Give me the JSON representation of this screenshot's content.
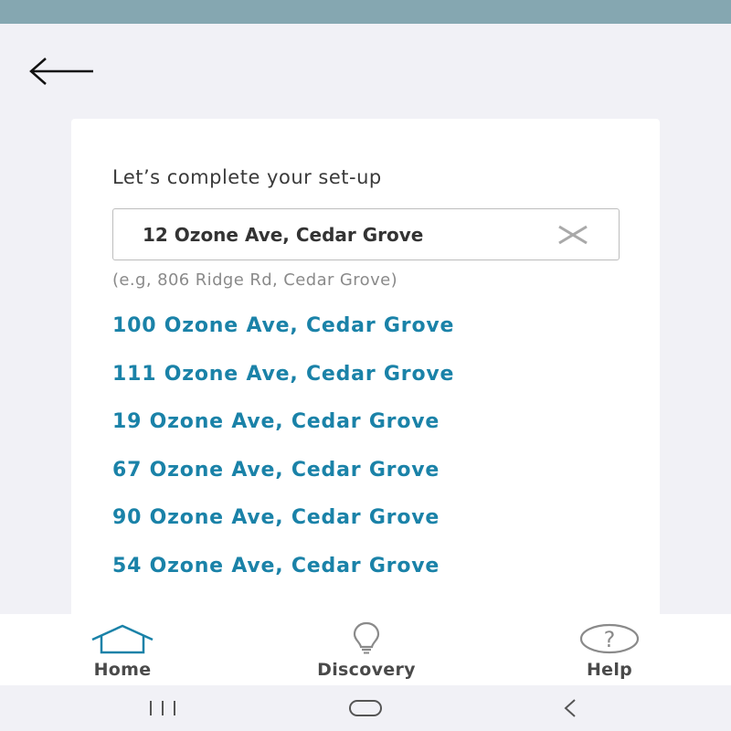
{
  "setup": {
    "title": "Let’s complete your set-up",
    "address_value": "12 Ozone Ave, Cedar Grove",
    "example_hint": "(e.g, 806 Ridge Rd, Cedar Grove)"
  },
  "suggestions": [
    "100 Ozone Ave, Cedar Grove",
    "111 Ozone Ave, Cedar Grove",
    "19 Ozone Ave, Cedar Grove",
    "67 Ozone Ave, Cedar Grove",
    "90 Ozone Ave, Cedar Grove",
    "54 Ozone Ave, Cedar Grove"
  ],
  "nav": {
    "home_label": "Home",
    "discovery_label": "Discovery",
    "help_label": "Help"
  },
  "icons": {
    "back": "arrow-left-icon",
    "clear": "close-icon",
    "home": "house-icon",
    "discovery": "lightbulb-icon",
    "help": "question-circle-icon"
  },
  "colors": {
    "status_bar": "#85a7b1",
    "accent": "#1a82a8",
    "background": "#f1f1f6"
  }
}
